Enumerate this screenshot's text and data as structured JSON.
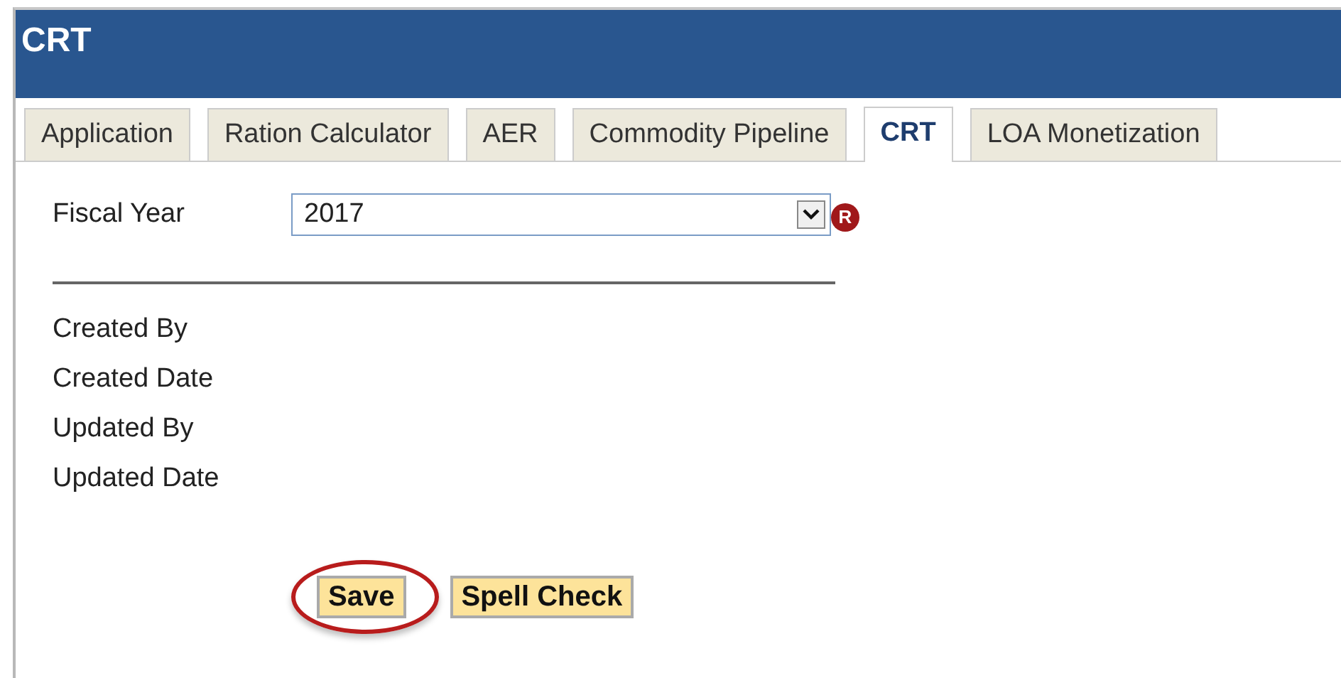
{
  "window": {
    "title": "CRT"
  },
  "tabs": [
    {
      "label": "Application",
      "selected": false
    },
    {
      "label": "Ration Calculator",
      "selected": false
    },
    {
      "label": "AER",
      "selected": false
    },
    {
      "label": "Commodity Pipeline",
      "selected": false
    },
    {
      "label": "CRT",
      "selected": true
    },
    {
      "label": "LOA Monetization",
      "selected": false
    }
  ],
  "fiscal_year": {
    "label": "Fiscal Year",
    "value": "2017",
    "required_badge": "R"
  },
  "audit_fields": [
    "Created By",
    "Created Date",
    "Updated By",
    "Updated Date"
  ],
  "buttons": [
    {
      "label": "Save",
      "highlighted": true
    },
    {
      "label": "Spell Check",
      "highlighted": false
    }
  ]
}
